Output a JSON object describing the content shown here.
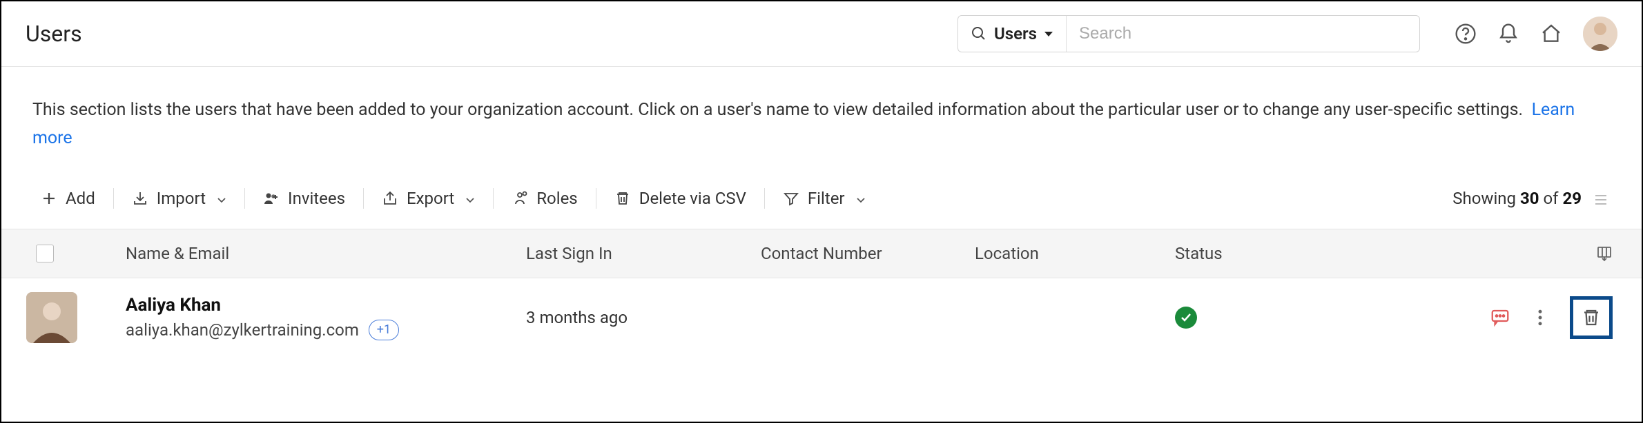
{
  "header": {
    "title": "Users",
    "search_scope": "Users",
    "search_placeholder": "Search"
  },
  "description": {
    "text": "This section lists the users that have been added to your organization account. Click on a user's name to view detailed information about the particular user or to change any user-specific settings.",
    "learn_more": "Learn more"
  },
  "toolbar": {
    "add": "Add",
    "import": "Import",
    "invitees": "Invitees",
    "export": "Export",
    "roles": "Roles",
    "delete_csv": "Delete via CSV",
    "filter": "Filter",
    "showing_prefix": "Showing",
    "showing_count": "30",
    "showing_of": "of",
    "showing_total": "29"
  },
  "columns": {
    "name": "Name & Email",
    "signin": "Last Sign In",
    "contact": "Contact Number",
    "location": "Location",
    "status": "Status"
  },
  "rows": [
    {
      "name": "Aaliya Khan",
      "email": "aaliya.khan@zylkertraining.com",
      "extra_badge": "+1",
      "last_signin": "3 months ago",
      "contact": "",
      "location": "",
      "status": "active"
    }
  ]
}
